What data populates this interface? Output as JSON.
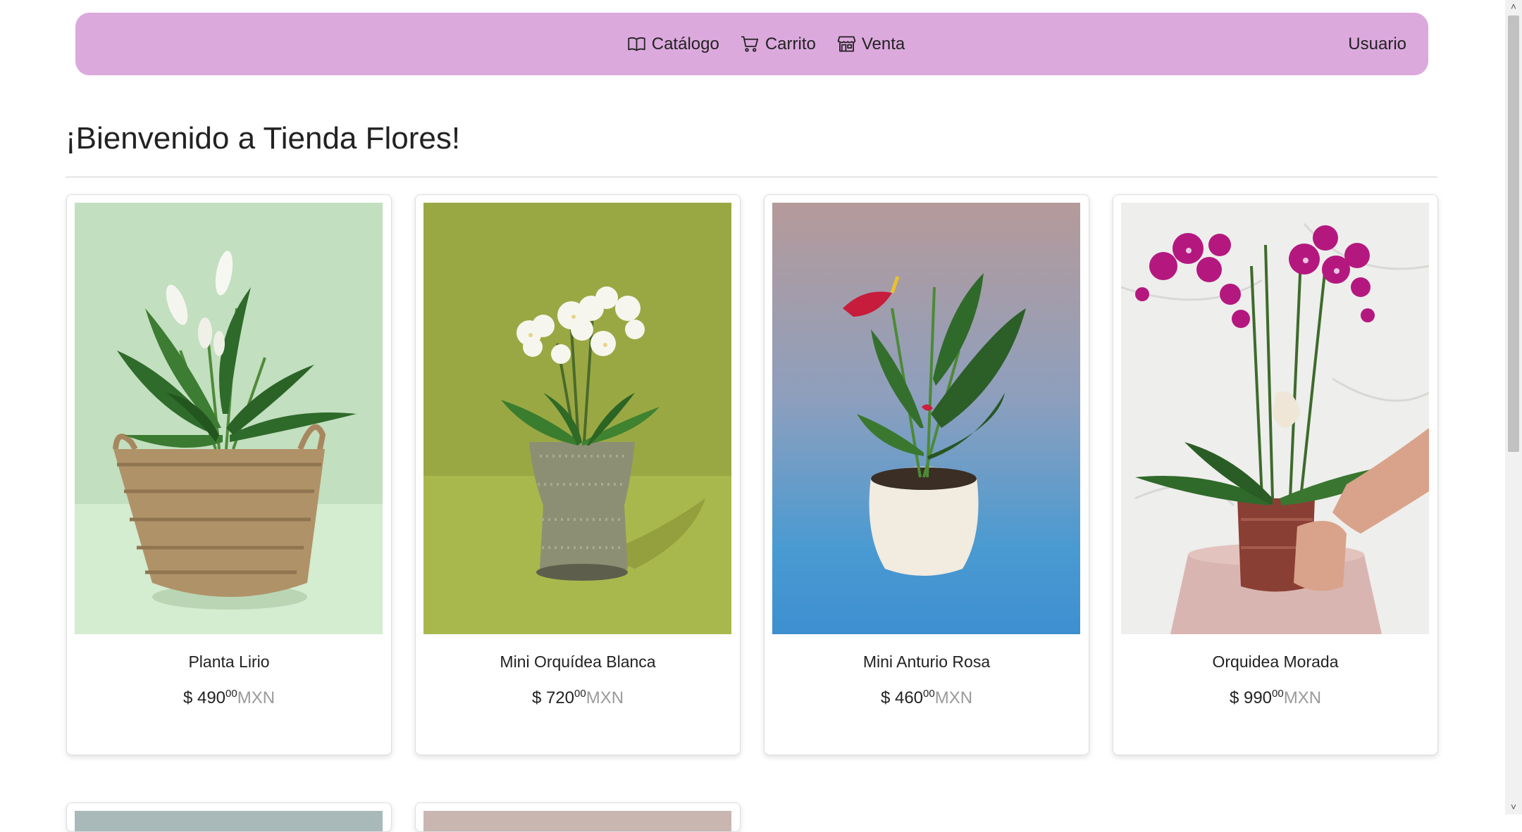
{
  "nav": {
    "catalog": "Catálogo",
    "cart": "Carrito",
    "sale": "Venta",
    "user": "Usuario"
  },
  "heading": "¡Bienvenido a Tienda Flores!",
  "products": [
    {
      "name": "Planta Lirio",
      "currency_symbol": "$",
      "price_whole": "490",
      "price_cents": "00",
      "currency": "MXN"
    },
    {
      "name": "Mini Orquídea Blanca",
      "currency_symbol": "$",
      "price_whole": "720",
      "price_cents": "00",
      "currency": "MXN"
    },
    {
      "name": "Mini Anturio Rosa",
      "currency_symbol": "$",
      "price_whole": "460",
      "price_cents": "00",
      "currency": "MXN"
    },
    {
      "name": "Orquidea Morada",
      "currency_symbol": "$",
      "price_whole": "990",
      "price_cents": "00",
      "currency": "MXN"
    }
  ],
  "colors": {
    "navbar": "#dca9dd",
    "currency_text": "#9a9a9a"
  }
}
